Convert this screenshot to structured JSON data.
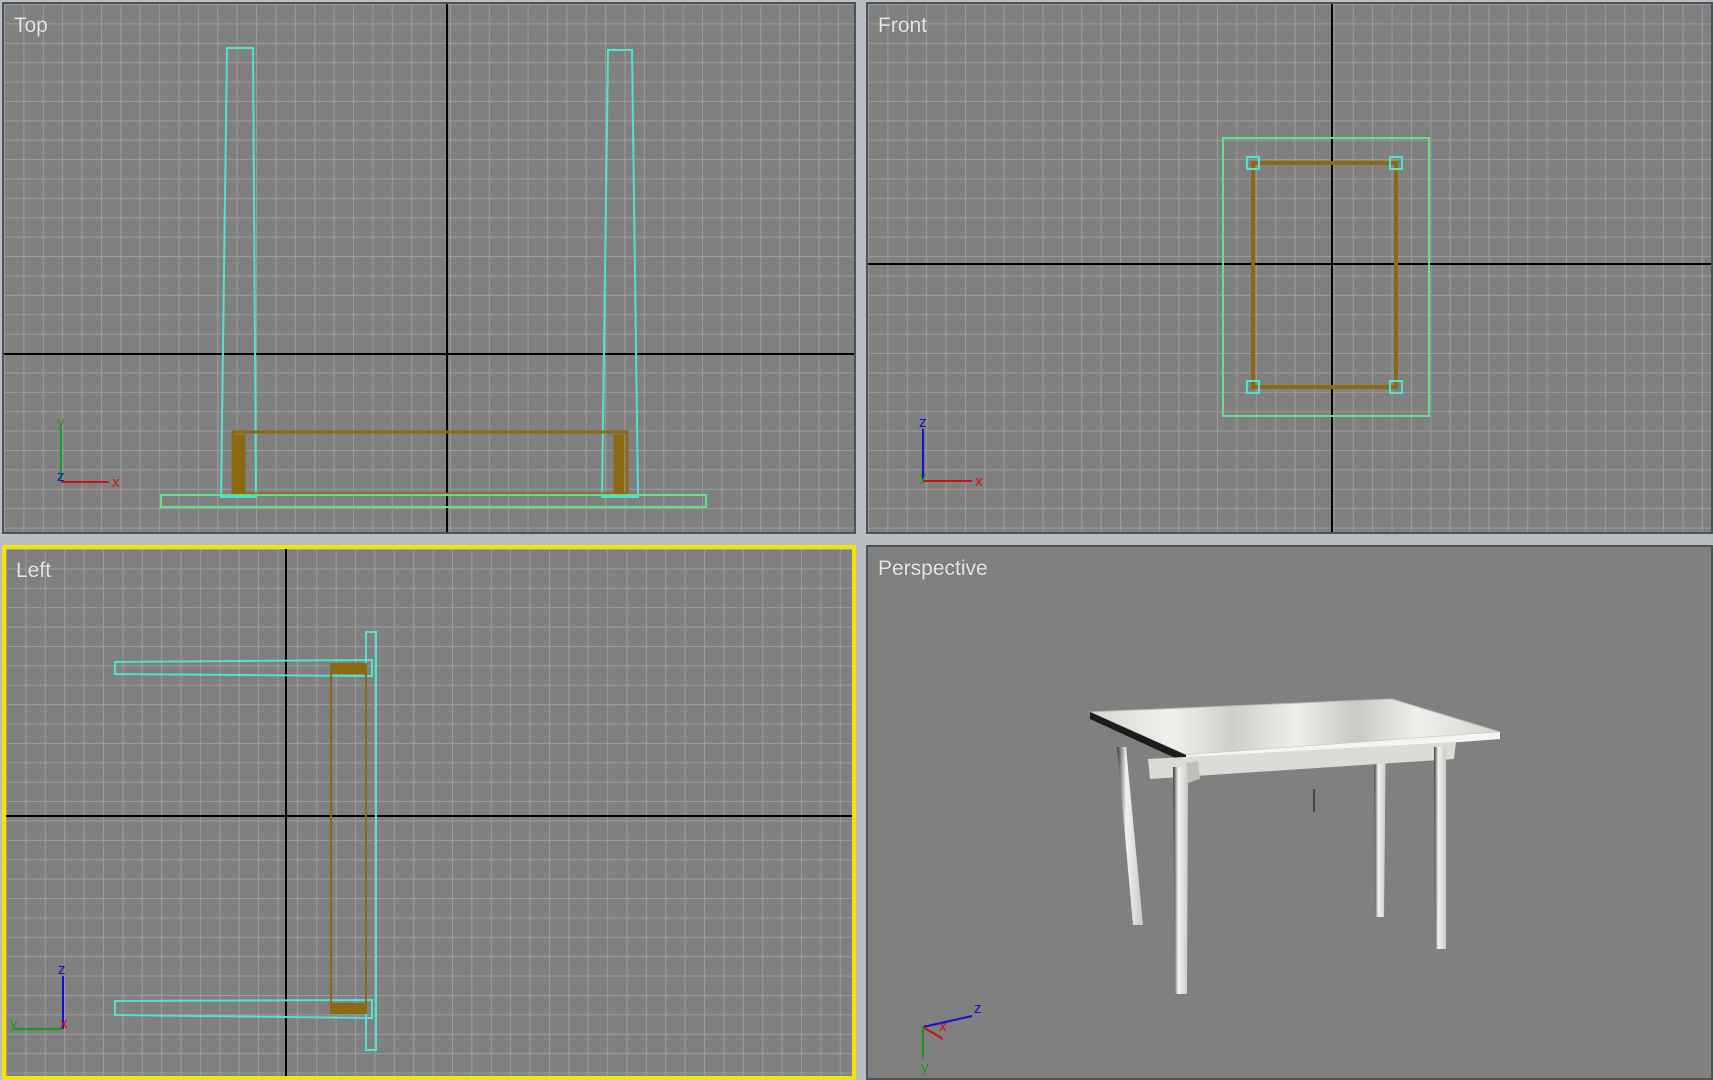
{
  "viewports": {
    "top": {
      "label": "Top",
      "active": false
    },
    "front": {
      "label": "Front",
      "active": false
    },
    "left": {
      "label": "Left",
      "active": true
    },
    "perspective": {
      "label": "Perspective",
      "active": false
    }
  },
  "axes": {
    "top": {
      "horizontal": "x",
      "vertical": "y",
      "depth": "z"
    },
    "front": {
      "horizontal": "x",
      "vertical": "z",
      "depth": "y"
    },
    "left": {
      "horizontal": "x",
      "vertical": "z",
      "depth": "y"
    },
    "perspective": {
      "a": "x",
      "b": "z",
      "c": "y"
    }
  },
  "colors": {
    "viewport_bg": "#808080",
    "grid_line": "#9c9c9c",
    "grid_major": "#000000",
    "wire_selected": "#4fe3d0",
    "wire_object": "#8c6a14",
    "bbox": "#62e08a",
    "active_border": "#f2e600",
    "axis_x": "#d01010",
    "axis_y": "#1a9a1a",
    "axis_z": "#1010d0"
  },
  "scene_object": "table"
}
